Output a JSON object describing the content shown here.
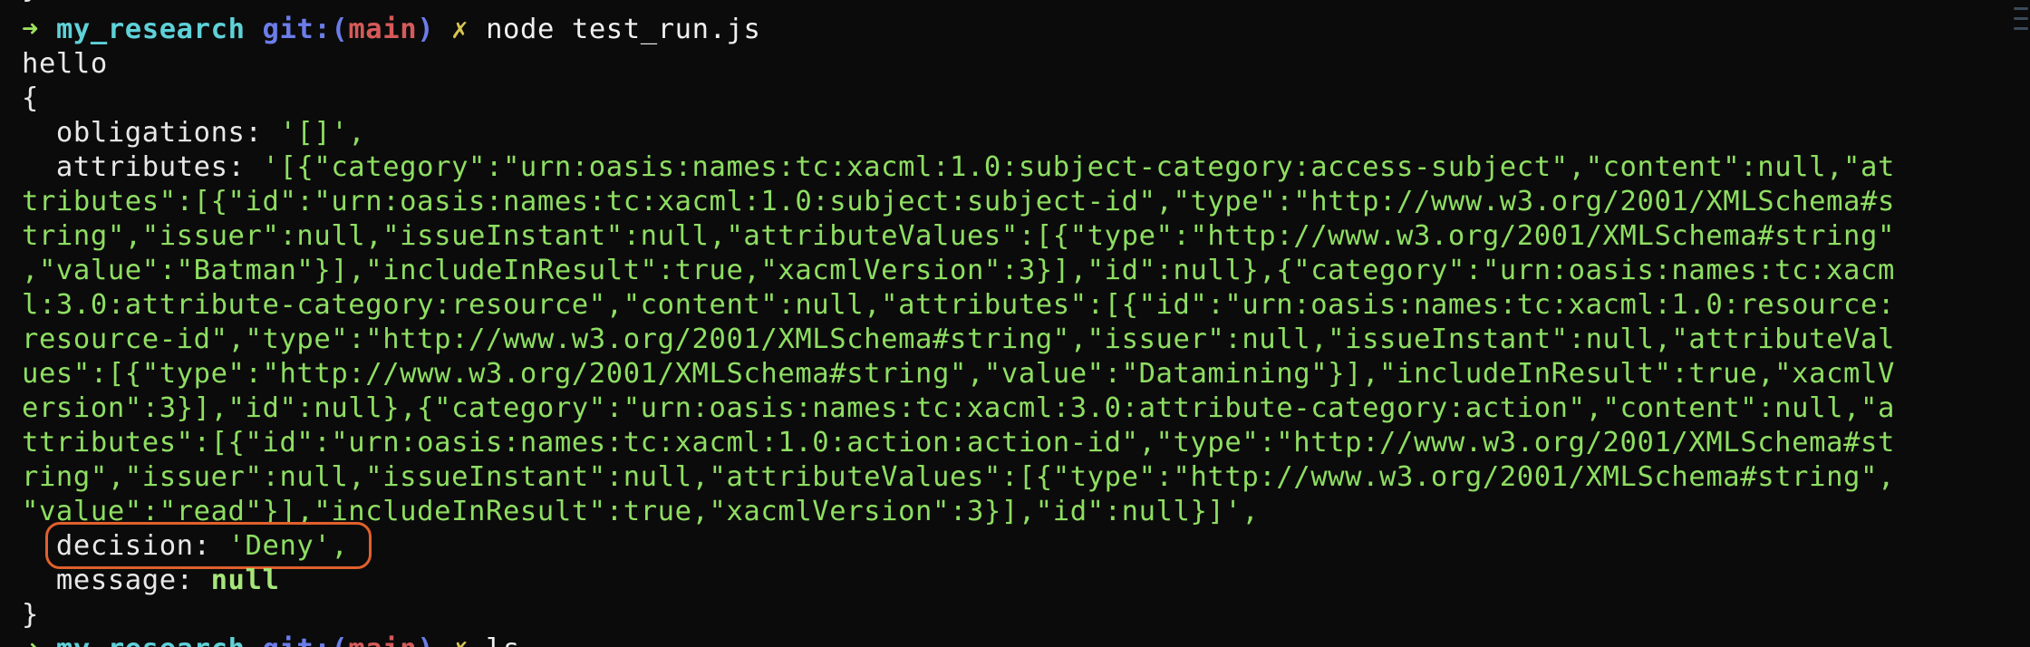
{
  "prompt1": {
    "arrow": "➜",
    "dir": "my_research",
    "git": "git:",
    "paren_open": "(",
    "branch": "main",
    "paren_close": ")",
    "dirty": "✗",
    "command": "node test_run.js"
  },
  "output": {
    "hello": "hello",
    "open_brace": "{",
    "obligations_key": "  obligations: ",
    "obligations_val": "'[]',",
    "attributes_key": "  attributes: ",
    "attributes_lines": [
      "'[{\"category\":\"urn:oasis:names:tc:xacml:1.0:subject-category:access-subject\",\"content\":null,\"at",
      "tributes\":[{\"id\":\"urn:oasis:names:tc:xacml:1.0:subject:subject-id\",\"type\":\"http://www.w3.org/2001/XMLSchema#s",
      "tring\",\"issuer\":null,\"issueInstant\":null,\"attributeValues\":[{\"type\":\"http://www.w3.org/2001/XMLSchema#string\"",
      ",\"value\":\"Batman\"}],\"includeInResult\":true,\"xacmlVersion\":3}],\"id\":null},{\"category\":\"urn:oasis:names:tc:xacm",
      "l:3.0:attribute-category:resource\",\"content\":null,\"attributes\":[{\"id\":\"urn:oasis:names:tc:xacml:1.0:resource:",
      "resource-id\",\"type\":\"http://www.w3.org/2001/XMLSchema#string\",\"issuer\":null,\"issueInstant\":null,\"attributeVal",
      "ues\":[{\"type\":\"http://www.w3.org/2001/XMLSchema#string\",\"value\":\"Datamining\"}],\"includeInResult\":true,\"xacmlV",
      "ersion\":3}],\"id\":null},{\"category\":\"urn:oasis:names:tc:xacml:3.0:attribute-category:action\",\"content\":null,\"a",
      "ttributes\":[{\"id\":\"urn:oasis:names:tc:xacml:1.0:action:action-id\",\"type\":\"http://www.w3.org/2001/XMLSchema#st",
      "ring\",\"issuer\":null,\"issueInstant\":null,\"attributeValues\":[{\"type\":\"http://www.w3.org/2001/XMLSchema#string\",",
      "\"value\":\"read\"}],\"includeInResult\":true,\"xacmlVersion\":3}],\"id\":null}]',"
    ],
    "decision_key": "  decision: ",
    "decision_val": "'Deny',",
    "message_key": "  message: ",
    "message_val": "null",
    "close_brace": "}"
  },
  "prompt2": {
    "arrow": "➜",
    "dir": "my_research",
    "git": "git:",
    "paren_open": "(",
    "branch": "main",
    "paren_close": ")",
    "dirty": "✗",
    "command": "ls"
  },
  "colors": {
    "background": "#0b0b0b",
    "string_green": "#8ede62",
    "highlight_orange": "#e0602c",
    "dir_cyan": "#5fd1d8",
    "git_blue": "#6c7dea",
    "branch_red": "#d65a5a"
  }
}
